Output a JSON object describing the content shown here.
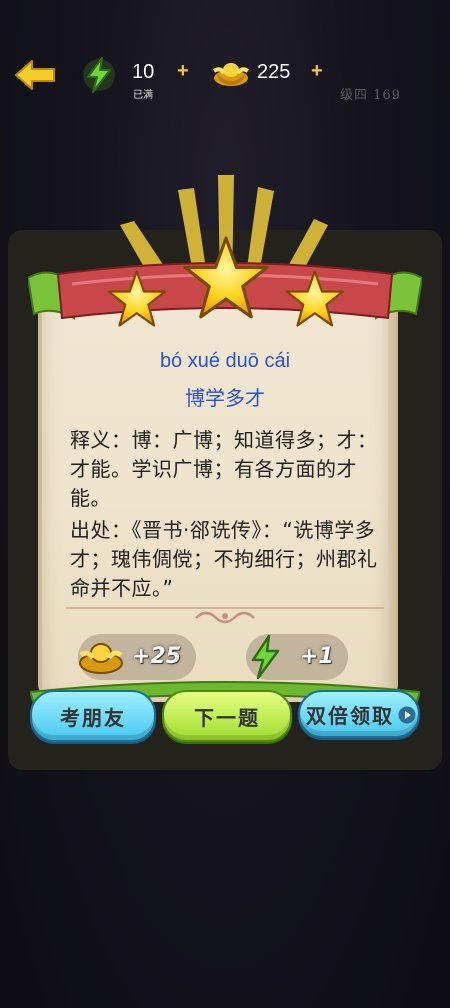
{
  "topbar": {
    "energy_value": "10",
    "energy_status": "已满",
    "coin_value": "225",
    "plus_symbol": "+",
    "level_label": "级四 169"
  },
  "card": {
    "stars_earned": 3,
    "pinyin": "bó xué duō cái",
    "idiom": "博学多才",
    "meaning": "释义：博：广博；知道得多；才：才能。学识广博；有各方面的才能。",
    "source": "出处：《晋书·郤诜传》：“诜博学多才；瑰伟倜傥；不拘细行；州郡礼命并不应。”"
  },
  "rewards": {
    "coins": "+25",
    "energy": "+1"
  },
  "buttons": {
    "ask_friend": "考朋友",
    "next": "下一题",
    "double": "双倍领取"
  },
  "colors": {
    "pinyin_blue": "#2b54c8",
    "accent_yellow": "#f7c62c",
    "button_blue": "#47c8ef",
    "button_green": "#9fdc2e"
  }
}
